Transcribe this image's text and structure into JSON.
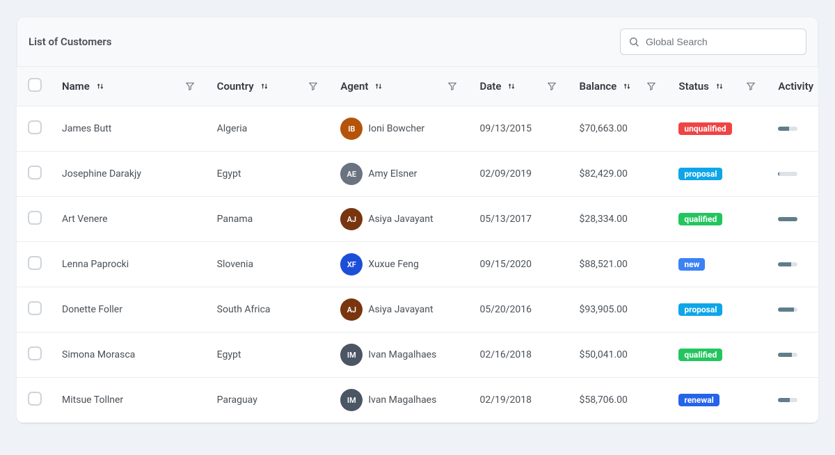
{
  "header": {
    "title": "List of Customers",
    "search_placeholder": "Global Search"
  },
  "columns": {
    "name": "Name",
    "country": "Country",
    "agent": "Agent",
    "date": "Date",
    "balance": "Balance",
    "status": "Status",
    "activity": "Activity"
  },
  "status_colors": {
    "unqualified": "#ef4444",
    "proposal": "#0ea5e9",
    "qualified": "#22c55e",
    "new": "#3b82f6",
    "renewal": "#2563eb"
  },
  "avatar_colors": {
    "Ioni Bowcher": "#b45309",
    "Amy Elsner": "#6b7280",
    "Asiya Javayant": "#78350f",
    "Xuxue Feng": "#1d4ed8",
    "Ivan Magalhaes": "#4b5563"
  },
  "rows": [
    {
      "name": "James Butt",
      "country": "Algeria",
      "agent": "Ioni Bowcher",
      "date": "09/13/2015",
      "balance": "$70,663.00",
      "status": "unqualified",
      "activity": 55
    },
    {
      "name": "Josephine Darakjy",
      "country": "Egypt",
      "agent": "Amy Elsner",
      "date": "02/09/2019",
      "balance": "$82,429.00",
      "status": "proposal",
      "activity": 5
    },
    {
      "name": "Art Venere",
      "country": "Panama",
      "agent": "Asiya Javayant",
      "date": "05/13/2017",
      "balance": "$28,334.00",
      "status": "qualified",
      "activity": 100
    },
    {
      "name": "Lenna Paprocki",
      "country": "Slovenia",
      "agent": "Xuxue Feng",
      "date": "09/15/2020",
      "balance": "$88,521.00",
      "status": "new",
      "activity": 65
    },
    {
      "name": "Donette Foller",
      "country": "South Africa",
      "agent": "Asiya Javayant",
      "date": "05/20/2016",
      "balance": "$93,905.00",
      "status": "proposal",
      "activity": 80
    },
    {
      "name": "Simona Morasca",
      "country": "Egypt",
      "agent": "Ivan Magalhaes",
      "date": "02/16/2018",
      "balance": "$50,041.00",
      "status": "qualified",
      "activity": 70
    },
    {
      "name": "Mitsue Tollner",
      "country": "Paraguay",
      "agent": "Ivan Magalhaes",
      "date": "02/19/2018",
      "balance": "$58,706.00",
      "status": "renewal",
      "activity": 60
    }
  ]
}
